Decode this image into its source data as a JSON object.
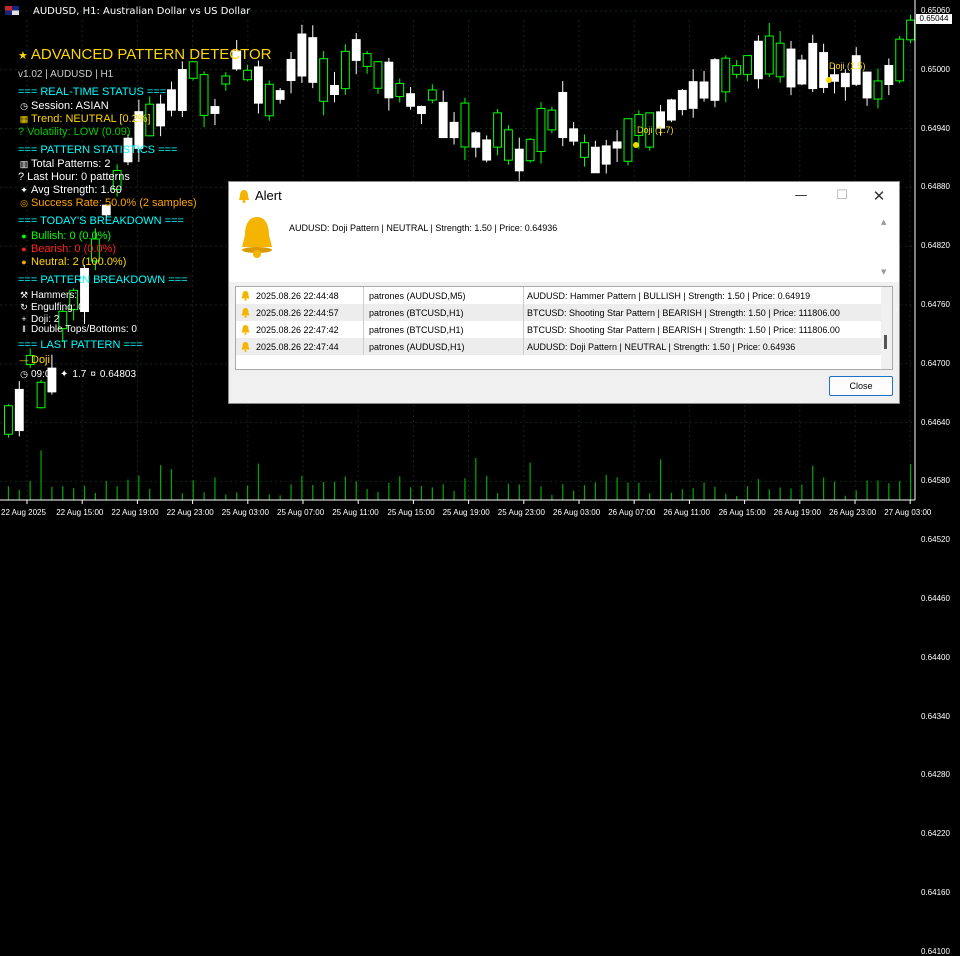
{
  "window": {
    "title": "AUDUSD, H1: Australian Dollar vs US Dollar"
  },
  "indicator": {
    "title": "ADVANCED PATTERN DETECTOR",
    "version": "v1.02 | AUDUSD | H1",
    "realtime_header": "=== REAL-TIME STATUS ===",
    "session": "Session: ASIAN",
    "trend": "Trend: NEUTRAL [0.2%]",
    "volatility": "? Volatility: LOW (0.09)",
    "stats_header": "=== PATTERN STATISTICS ===",
    "total_patterns": "Total Patterns: 2",
    "last_hour": "? Last Hour: 0 patterns",
    "avg_strength": "Avg Strength: 1.60",
    "success_rate": "Success Rate: 50.0% (2 samples)",
    "today_header": "=== TODAY'S BREAKDOWN ===",
    "bullish": "Bullish: 0 (0.0%)",
    "bearish": "Bearish: 0 (0.0%)",
    "neutral": "Neutral: 2 (100.0%)",
    "breakdown_header": "=== PATTERN BREAKDOWN ===",
    "hammers": "Hammers: 0",
    "engulfing": "Engulfing: 0",
    "doji": "Doji: 2",
    "double_tops": "Double Tops/Bottoms: 0",
    "last_pattern_header": "=== LAST PATTERN ===",
    "last_pattern_name": "Doji",
    "last_pattern_time": "09:00",
    "last_pattern_strength": "1.7",
    "last_pattern_price": "0.64803"
  },
  "chart_markers": [
    {
      "label": "Doji (1.7)"
    },
    {
      "label": "Doji (1.5)"
    }
  ],
  "price_axis": {
    "current_price": "0.65044",
    "labels": [
      "0.65060",
      "0.65000",
      "0.64940",
      "0.64880",
      "0.64820",
      "0.64760",
      "0.64700",
      "0.64640",
      "0.64580",
      "0.64520",
      "0.64460",
      "0.64400",
      "0.64340",
      "0.64280",
      "0.64220",
      "0.64160",
      "0.64100"
    ]
  },
  "time_axis": {
    "labels": [
      "22 Aug 2025",
      "22 Aug 15:00",
      "22 Aug 19:00",
      "22 Aug 23:00",
      "25 Aug 03:00",
      "25 Aug 07:00",
      "25 Aug 11:00",
      "25 Aug 15:00",
      "25 Aug 19:00",
      "25 Aug 23:00",
      "26 Aug 03:00",
      "26 Aug 07:00",
      "26 Aug 11:00",
      "26 Aug 15:00",
      "26 Aug 19:00",
      "26 Aug 23:00",
      "27 Aug 03:00"
    ]
  },
  "alert": {
    "title": "Alert",
    "message": "AUDUSD: Doji Pattern | NEUTRAL | Strength: 1.50 | Price: 0.64936",
    "rows": [
      {
        "time": "2025.08.26 22:44:48",
        "source": "patrones (AUDUSD,M5)",
        "message": "AUDUSD: Hammer Pattern | BULLISH | Strength: 1.50 | Price: 0.64919"
      },
      {
        "time": "2025.08.26 22:44:57",
        "source": "patrones (BTCUSD,H1)",
        "message": "BTCUSD: Shooting Star Pattern | BEARISH | Strength: 1.50 | Price: 111806.00"
      },
      {
        "time": "2025.08.26 22:47:42",
        "source": "patrones (BTCUSD,H1)",
        "message": "BTCUSD: Shooting Star Pattern | BEARISH | Strength: 1.50 | Price: 111806.00"
      },
      {
        "time": "2025.08.26 22:47:44",
        "source": "patrones (AUDUSD,H1)",
        "message": "AUDUSD: Doji Pattern | NEUTRAL | Strength: 1.50 | Price: 0.64936"
      }
    ],
    "close_label": "Close"
  },
  "colors": {
    "bull": "#00ff00",
    "bear": "#ffffff",
    "grid": "#1c2a1c",
    "accent_yellow": "#ffd700",
    "cyan": "#00ffff"
  }
}
